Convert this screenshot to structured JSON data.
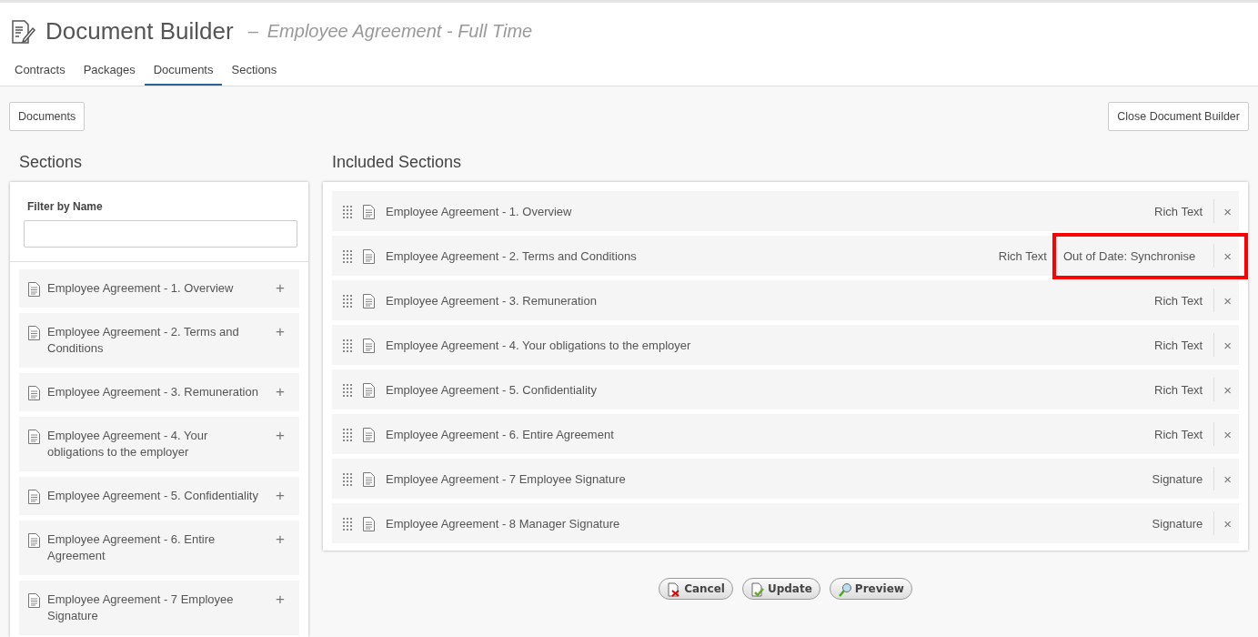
{
  "header": {
    "title": "Document Builder",
    "separator": "–",
    "subtitle": "Employee Agreement - Full Time"
  },
  "tabs": [
    {
      "label": "Contracts",
      "selected": false
    },
    {
      "label": "Packages",
      "selected": false
    },
    {
      "label": "Documents",
      "selected": true
    },
    {
      "label": "Sections",
      "selected": false
    }
  ],
  "toolbar": {
    "left_button": "Documents",
    "right_button": "Close Document Builder"
  },
  "sections_panel": {
    "heading": "Sections",
    "filter_label": "Filter by Name",
    "items": [
      {
        "name": "Employee Agreement - 1. Overview",
        "add": "+"
      },
      {
        "name": "Employee Agreement - 2. Terms and Conditions",
        "add": "+"
      },
      {
        "name": "Employee Agreement - 3. Remuneration",
        "add": "+"
      },
      {
        "name": "Employee Agreement - 4. Your obligations to the employer",
        "add": "+"
      },
      {
        "name": "Employee Agreement - 5. Confidentiality",
        "add": "+"
      },
      {
        "name": "Employee Agreement - 6. Entire Agreement",
        "add": "+"
      },
      {
        "name": "Employee Agreement - 7 Employee Signature",
        "add": "+"
      }
    ]
  },
  "included_panel": {
    "heading": "Included Sections",
    "rows": [
      {
        "name": "Employee Agreement - 1. Overview",
        "type": "Rich Text",
        "remove": "×"
      },
      {
        "name": "Employee Agreement - 2. Terms and Conditions",
        "type": "Rich Text",
        "status": "Out of Date: Synchronise",
        "highlighted": true,
        "remove": "×"
      },
      {
        "name": "Employee Agreement - 3. Remuneration",
        "type": "Rich Text",
        "remove": "×"
      },
      {
        "name": "Employee Agreement - 4. Your obligations to the employer",
        "type": "Rich Text",
        "remove": "×"
      },
      {
        "name": "Employee Agreement - 5. Confidentiality",
        "type": "Rich Text",
        "remove": "×"
      },
      {
        "name": "Employee Agreement - 6. Entire Agreement",
        "type": "Rich Text",
        "remove": "×"
      },
      {
        "name": "Employee Agreement - 7 Employee Signature",
        "type": "Signature",
        "remove": "×"
      },
      {
        "name": "Employee Agreement - 8 Manager Signature",
        "type": "Signature",
        "remove": "×"
      }
    ]
  },
  "actions": [
    {
      "label": "Cancel",
      "kind": "cancel"
    },
    {
      "label": "Update",
      "kind": "update"
    },
    {
      "label": "Preview",
      "kind": "preview"
    }
  ]
}
